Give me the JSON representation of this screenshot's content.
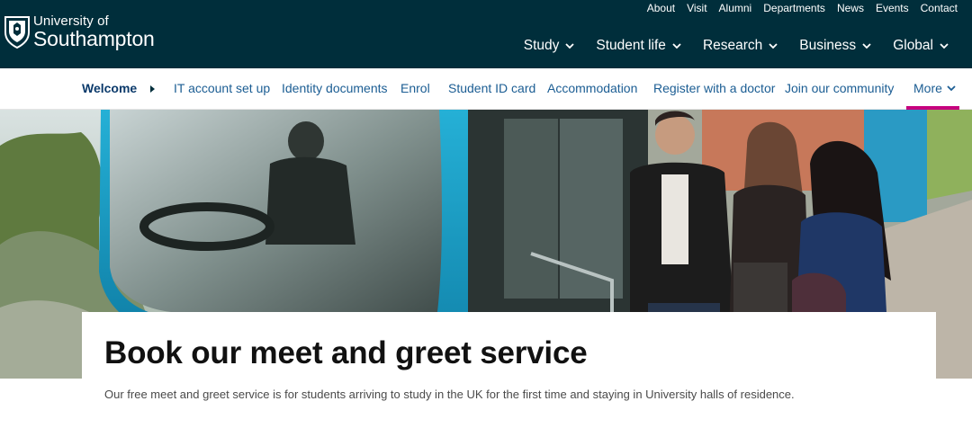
{
  "brand": {
    "line1": "University of",
    "line2": "Southampton",
    "crest_icon": "shield-crest-icon"
  },
  "utility_nav": [
    "About",
    "Visit",
    "Alumni",
    "Departments",
    "News",
    "Events",
    "Contact"
  ],
  "main_nav": [
    "Study",
    "Student life",
    "Research",
    "Business",
    "Global"
  ],
  "sub_nav": {
    "welcome": "Welcome",
    "items": [
      "IT account set up",
      "Identity documents",
      "Enrol",
      "Student ID card",
      "Accommodation",
      "Register with a doctor",
      "Join our community"
    ],
    "more": "More"
  },
  "page": {
    "title": "Book our meet and greet service",
    "intro": "Our free meet and greet service is for students arriving to study in the UK for the first time and staying in University halls of residence."
  },
  "colors": {
    "header_bg": "#002e3b",
    "link": "#1b5d93",
    "accent": "#c6007e",
    "bus_blue": "#1aa0c8"
  }
}
